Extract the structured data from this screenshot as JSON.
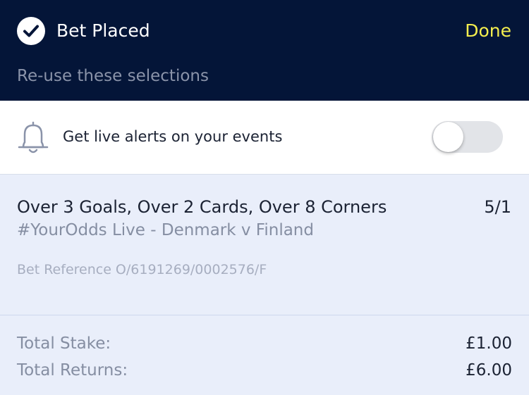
{
  "header": {
    "title": "Bet Placed",
    "done_label": "Done",
    "reuse_label": "Re-use these selections",
    "status_icon": "check-circle-icon"
  },
  "alerts": {
    "label": "Get live alerts on your events",
    "icon": "bell-icon",
    "toggle_on": false
  },
  "selection": {
    "title": "Over 3 Goals, Over 2 Cards, Over 8 Corners",
    "odds": "5/1",
    "event": "#YourOdds Live - Denmark v Finland",
    "reference": "Bet Reference O/6191269/0002576/F"
  },
  "totals": {
    "stake_label": "Total Stake:",
    "stake_value": "£1.00",
    "returns_label": "Total Returns:",
    "returns_value": "£6.00"
  },
  "colors": {
    "header_bg": "#041538",
    "done_accent": "#f4ee4e",
    "panel_bg": "#e9eefa"
  }
}
